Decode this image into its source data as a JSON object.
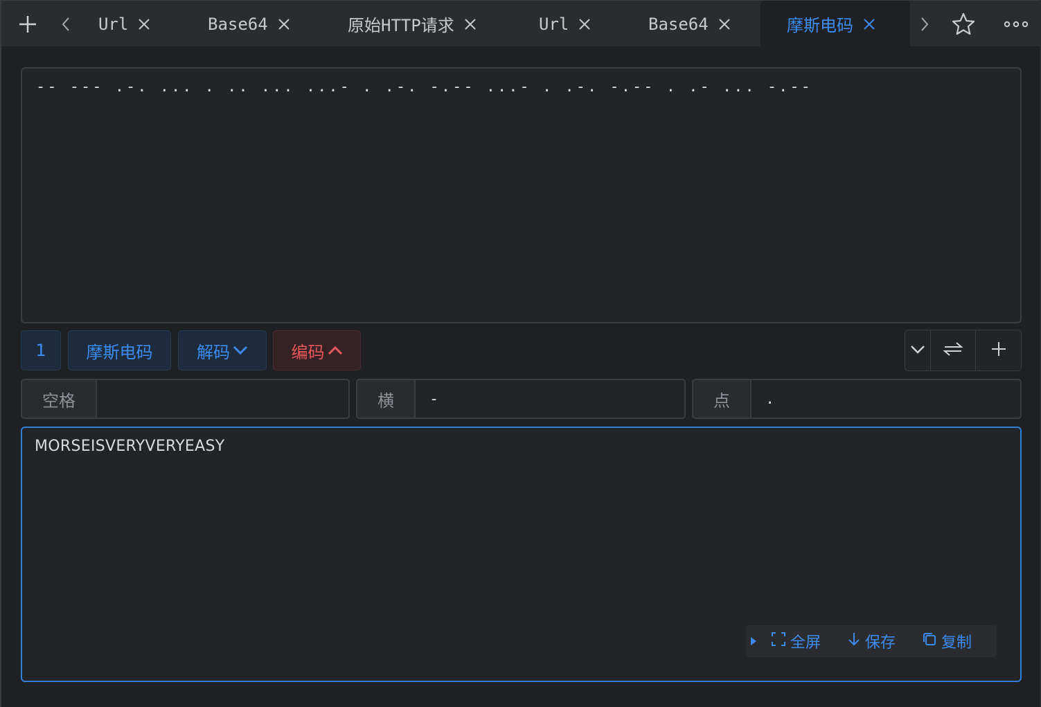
{
  "tabbar": {
    "icons": {
      "new_tab": "plus-icon",
      "prev": "chevron-left-icon",
      "next": "chevron-right-icon",
      "favorite": "star-icon",
      "more": "more-icon"
    },
    "tabs": [
      {
        "label": "Url",
        "active": false
      },
      {
        "label": "Base64",
        "active": false
      },
      {
        "label": "原始HTTP请求",
        "active": false
      },
      {
        "label": "Url",
        "active": false
      },
      {
        "label": "Base64",
        "active": false
      },
      {
        "label": "摩斯电码",
        "active": true
      }
    ]
  },
  "input": {
    "value": "-- --- .-. ... . .. ... ...- . .-. -.-- ...- . .-. -.-- . .- ... -.--"
  },
  "toolbar": {
    "step_number": "1",
    "tool_name": "摩斯电码",
    "decode_label": "解码",
    "encode_label": "编码"
  },
  "params": {
    "space": {
      "label": "空格",
      "value": ""
    },
    "dash": {
      "label": "横",
      "value": "-"
    },
    "dot": {
      "label": "点",
      "value": "."
    }
  },
  "output": {
    "value": "MORSEISVERYVERYEASY",
    "actions": {
      "fullscreen": "全屏",
      "save": "保存",
      "copy": "复制"
    }
  },
  "colors": {
    "accent": "#3c8cf0",
    "encode_red": "#e8575b",
    "background": "#1f2023"
  }
}
